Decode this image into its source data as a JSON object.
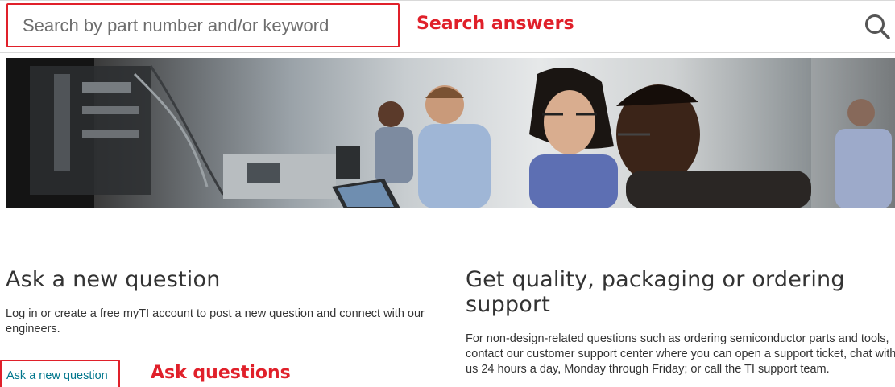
{
  "search": {
    "placeholder": "Search by part number and/or keyword",
    "annotation": "Search answers",
    "icon": "search-icon"
  },
  "hero": {
    "image": "engineers-at-workbench-photo"
  },
  "ask": {
    "heading": "Ask a new question",
    "body": "Log in or create a free myTI account to post a new question and connect with our engineers.",
    "link_label": "Ask a new question",
    "annotation": "Ask questions"
  },
  "support": {
    "heading": "Get quality, packaging or ordering support",
    "body": "For non-design-related questions such as ordering semiconductor parts and tools, contact our customer support center where you can open a support ticket, chat with us 24 hours a day, Monday through Friday; or call the TI support team."
  },
  "colors": {
    "annotation_red": "#e0202a",
    "link_teal": "#00768c",
    "text": "#333333"
  }
}
